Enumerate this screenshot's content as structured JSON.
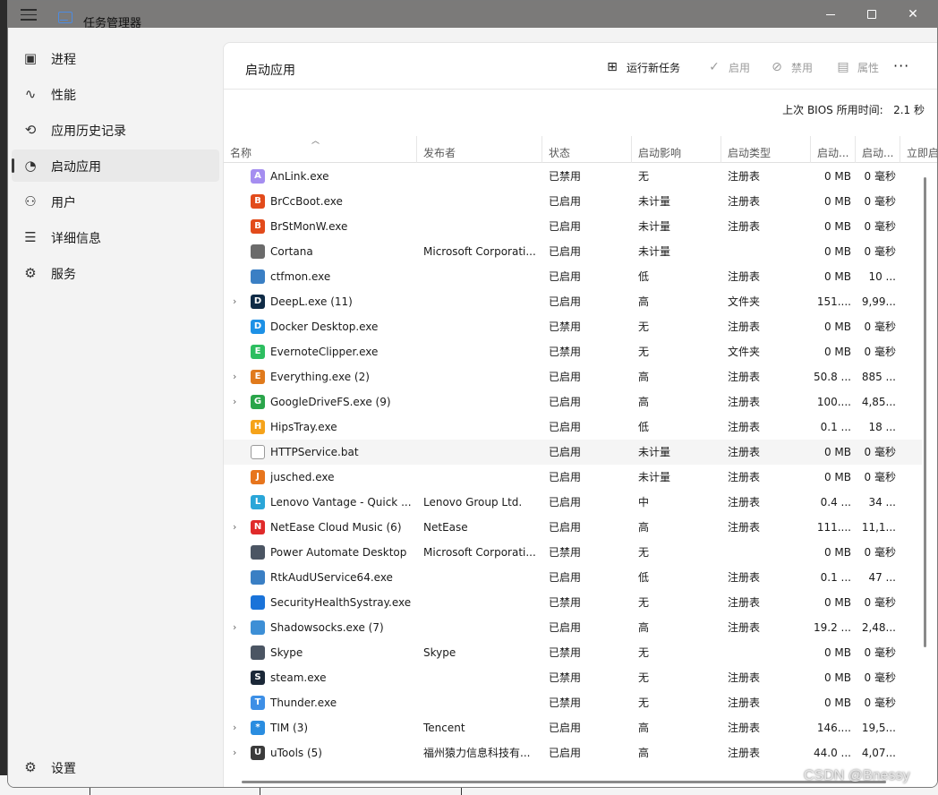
{
  "window": {
    "title": "任务管理器"
  },
  "sidebar": {
    "items": [
      {
        "label": "进程",
        "icon": "processes-icon"
      },
      {
        "label": "性能",
        "icon": "performance-icon"
      },
      {
        "label": "应用历史记录",
        "icon": "history-icon"
      },
      {
        "label": "启动应用",
        "icon": "startup-icon",
        "active": true
      },
      {
        "label": "用户",
        "icon": "users-icon"
      },
      {
        "label": "详细信息",
        "icon": "details-icon"
      },
      {
        "label": "服务",
        "icon": "services-icon"
      }
    ],
    "settings_label": "设置"
  },
  "header": {
    "title": "启动应用",
    "run_new_task": "运行新任务",
    "enable": "启用",
    "disable": "禁用",
    "properties": "属性",
    "more": "···"
  },
  "bios": {
    "label": "上次 BIOS 所用时间:",
    "value": "2.1 秒"
  },
  "table": {
    "columns": [
      "名称",
      "发布者",
      "状态",
      "启动影响",
      "启动类型",
      "启动...",
      "启动...",
      "立即启"
    ],
    "rows": [
      {
        "expand": false,
        "icon": "anlink-icon",
        "color": "#a58ef0",
        "glyph": "A",
        "name": "AnLink.exe",
        "publisher": "",
        "status": "已禁用",
        "impact": "无",
        "type": "注册表",
        "disk": "0 MB",
        "cpu": "0 毫秒"
      },
      {
        "expand": false,
        "icon": "brcc-icon",
        "color": "#e24b1b",
        "glyph": "B",
        "name": "BrCcBoot.exe",
        "publisher": "",
        "status": "已启用",
        "impact": "未计量",
        "type": "注册表",
        "disk": "0 MB",
        "cpu": "0 毫秒"
      },
      {
        "expand": false,
        "icon": "brst-icon",
        "color": "#e24b1b",
        "glyph": "B",
        "name": "BrStMonW.exe",
        "publisher": "",
        "status": "已启用",
        "impact": "未计量",
        "type": "注册表",
        "disk": "0 MB",
        "cpu": "0 毫秒"
      },
      {
        "expand": false,
        "icon": "cortana-icon",
        "color": "#6b6b6b",
        "glyph": "",
        "name": "Cortana",
        "publisher": "Microsoft Corporati...",
        "status": "已启用",
        "impact": "未计量",
        "type": "",
        "disk": "0 MB",
        "cpu": "0 毫秒"
      },
      {
        "expand": false,
        "icon": "ctfmon-icon",
        "color": "#3a7fc4",
        "glyph": "",
        "name": "ctfmon.exe",
        "publisher": "",
        "status": "已启用",
        "impact": "低",
        "type": "注册表",
        "disk": "0 MB",
        "cpu": "10 ..."
      },
      {
        "expand": true,
        "icon": "deepl-icon",
        "color": "#0f2b46",
        "glyph": "D",
        "name": "DeepL.exe (11)",
        "publisher": "",
        "status": "已启用",
        "impact": "高",
        "type": "文件夹",
        "disk": "151....",
        "cpu": "9,99..."
      },
      {
        "expand": false,
        "icon": "docker-icon",
        "color": "#1d91e6",
        "glyph": "D",
        "name": "Docker Desktop.exe",
        "publisher": "",
        "status": "已禁用",
        "impact": "无",
        "type": "注册表",
        "disk": "0 MB",
        "cpu": "0 毫秒"
      },
      {
        "expand": false,
        "icon": "evernote-icon",
        "color": "#2dbe60",
        "glyph": "E",
        "name": "EvernoteClipper.exe",
        "publisher": "",
        "status": "已禁用",
        "impact": "无",
        "type": "文件夹",
        "disk": "0 MB",
        "cpu": "0 毫秒"
      },
      {
        "expand": true,
        "icon": "everything-icon",
        "color": "#e07a1c",
        "glyph": "E",
        "name": "Everything.exe (2)",
        "publisher": "",
        "status": "已启用",
        "impact": "高",
        "type": "注册表",
        "disk": "50.8 ...",
        "cpu": "885 ..."
      },
      {
        "expand": true,
        "icon": "gdrive-icon",
        "color": "#2aa54a",
        "glyph": "G",
        "name": "GoogleDriveFS.exe (9)",
        "publisher": "",
        "status": "已启用",
        "impact": "高",
        "type": "注册表",
        "disk": "100....",
        "cpu": "4,85..."
      },
      {
        "expand": false,
        "icon": "hipstray-icon",
        "color": "#f5a31a",
        "glyph": "H",
        "name": "HipsTray.exe",
        "publisher": "",
        "status": "已启用",
        "impact": "低",
        "type": "注册表",
        "disk": "0.1 ...",
        "cpu": "18 ..."
      },
      {
        "expand": false,
        "icon": "bat-file-icon",
        "color": "#ffffff",
        "glyph": "",
        "name": "HTTPService.bat",
        "publisher": "",
        "status": "已启用",
        "impact": "未计量",
        "type": "注册表",
        "disk": "0 MB",
        "cpu": "0 毫秒",
        "highlight": true
      },
      {
        "expand": false,
        "icon": "java-icon",
        "color": "#e7751d",
        "glyph": "J",
        "name": "jusched.exe",
        "publisher": "",
        "status": "已启用",
        "impact": "未计量",
        "type": "注册表",
        "disk": "0 MB",
        "cpu": "0 毫秒"
      },
      {
        "expand": false,
        "icon": "lenovo-icon",
        "color": "#2aa6d8",
        "glyph": "L",
        "name": "Lenovo Vantage - Quick ...",
        "publisher": "Lenovo Group Ltd.",
        "status": "已启用",
        "impact": "中",
        "type": "注册表",
        "disk": "0.4 ...",
        "cpu": "34 ..."
      },
      {
        "expand": true,
        "icon": "netease-icon",
        "color": "#e02a2a",
        "glyph": "N",
        "name": "NetEase Cloud Music (6)",
        "publisher": "NetEase",
        "status": "已启用",
        "impact": "高",
        "type": "注册表",
        "disk": "111....",
        "cpu": "11,1..."
      },
      {
        "expand": false,
        "icon": "power-automate-icon",
        "color": "#4b5563",
        "glyph": "",
        "name": "Power Automate Desktop",
        "publisher": "Microsoft Corporati...",
        "status": "已禁用",
        "impact": "无",
        "type": "",
        "disk": "0 MB",
        "cpu": "0 毫秒"
      },
      {
        "expand": false,
        "icon": "rtk-icon",
        "color": "#3a7fc4",
        "glyph": "",
        "name": "RtkAudUService64.exe",
        "publisher": "",
        "status": "已启用",
        "impact": "低",
        "type": "注册表",
        "disk": "0.1 ...",
        "cpu": "47 ..."
      },
      {
        "expand": false,
        "icon": "shield-icon",
        "color": "#1a73d9",
        "glyph": "",
        "name": "SecurityHealthSystray.exe",
        "publisher": "",
        "status": "已禁用",
        "impact": "无",
        "type": "注册表",
        "disk": "0 MB",
        "cpu": "0 毫秒"
      },
      {
        "expand": true,
        "icon": "shadowsocks-icon",
        "color": "#3d8fd6",
        "glyph": "",
        "name": "Shadowsocks.exe (7)",
        "publisher": "",
        "status": "已启用",
        "impact": "高",
        "type": "注册表",
        "disk": "19.2 ...",
        "cpu": "2,48..."
      },
      {
        "expand": false,
        "icon": "skype-icon",
        "color": "#4b5563",
        "glyph": "",
        "name": "Skype",
        "publisher": "Skype",
        "status": "已禁用",
        "impact": "无",
        "type": "",
        "disk": "0 MB",
        "cpu": "0 毫秒"
      },
      {
        "expand": false,
        "icon": "steam-icon",
        "color": "#1b2838",
        "glyph": "S",
        "name": "steam.exe",
        "publisher": "",
        "status": "已禁用",
        "impact": "无",
        "type": "注册表",
        "disk": "0 MB",
        "cpu": "0 毫秒"
      },
      {
        "expand": false,
        "icon": "thunder-icon",
        "color": "#3d8fe6",
        "glyph": "T",
        "name": "Thunder.exe",
        "publisher": "",
        "status": "已禁用",
        "impact": "无",
        "type": "注册表",
        "disk": "0 MB",
        "cpu": "0 毫秒"
      },
      {
        "expand": true,
        "icon": "tim-icon",
        "color": "#2a8de0",
        "glyph": "*",
        "name": "TIM (3)",
        "publisher": "Tencent",
        "status": "已启用",
        "impact": "高",
        "type": "注册表",
        "disk": "146....",
        "cpu": "19,5..."
      },
      {
        "expand": true,
        "icon": "utools-icon",
        "color": "#3b3b3b",
        "glyph": "U",
        "name": "uTools (5)",
        "publisher": "福州猿力信息科技有...",
        "status": "已启用",
        "impact": "高",
        "type": "注册表",
        "disk": "44.0 ...",
        "cpu": "4,07..."
      }
    ]
  },
  "watermark": "CSDN @Bnessy"
}
